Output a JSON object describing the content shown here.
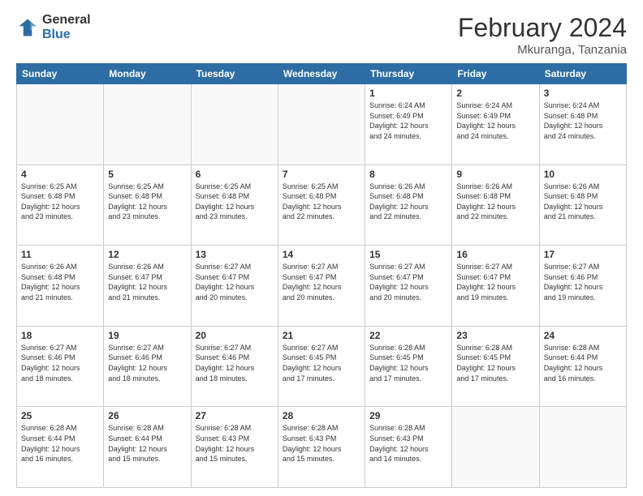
{
  "logo": {
    "general": "General",
    "blue": "Blue"
  },
  "title": "February 2024",
  "subtitle": "Mkuranga, Tanzania",
  "headers": [
    "Sunday",
    "Monday",
    "Tuesday",
    "Wednesday",
    "Thursday",
    "Friday",
    "Saturday"
  ],
  "weeks": [
    [
      {
        "day": "",
        "info": ""
      },
      {
        "day": "",
        "info": ""
      },
      {
        "day": "",
        "info": ""
      },
      {
        "day": "",
        "info": ""
      },
      {
        "day": "1",
        "info": "Sunrise: 6:24 AM\nSunset: 6:49 PM\nDaylight: 12 hours\nand 24 minutes."
      },
      {
        "day": "2",
        "info": "Sunrise: 6:24 AM\nSunset: 6:49 PM\nDaylight: 12 hours\nand 24 minutes."
      },
      {
        "day": "3",
        "info": "Sunrise: 6:24 AM\nSunset: 6:48 PM\nDaylight: 12 hours\nand 24 minutes."
      }
    ],
    [
      {
        "day": "4",
        "info": "Sunrise: 6:25 AM\nSunset: 6:48 PM\nDaylight: 12 hours\nand 23 minutes."
      },
      {
        "day": "5",
        "info": "Sunrise: 6:25 AM\nSunset: 6:48 PM\nDaylight: 12 hours\nand 23 minutes."
      },
      {
        "day": "6",
        "info": "Sunrise: 6:25 AM\nSunset: 6:48 PM\nDaylight: 12 hours\nand 23 minutes."
      },
      {
        "day": "7",
        "info": "Sunrise: 6:25 AM\nSunset: 6:48 PM\nDaylight: 12 hours\nand 22 minutes."
      },
      {
        "day": "8",
        "info": "Sunrise: 6:26 AM\nSunset: 6:48 PM\nDaylight: 12 hours\nand 22 minutes."
      },
      {
        "day": "9",
        "info": "Sunrise: 6:26 AM\nSunset: 6:48 PM\nDaylight: 12 hours\nand 22 minutes."
      },
      {
        "day": "10",
        "info": "Sunrise: 6:26 AM\nSunset: 6:48 PM\nDaylight: 12 hours\nand 21 minutes."
      }
    ],
    [
      {
        "day": "11",
        "info": "Sunrise: 6:26 AM\nSunset: 6:48 PM\nDaylight: 12 hours\nand 21 minutes."
      },
      {
        "day": "12",
        "info": "Sunrise: 6:26 AM\nSunset: 6:47 PM\nDaylight: 12 hours\nand 21 minutes."
      },
      {
        "day": "13",
        "info": "Sunrise: 6:27 AM\nSunset: 6:47 PM\nDaylight: 12 hours\nand 20 minutes."
      },
      {
        "day": "14",
        "info": "Sunrise: 6:27 AM\nSunset: 6:47 PM\nDaylight: 12 hours\nand 20 minutes."
      },
      {
        "day": "15",
        "info": "Sunrise: 6:27 AM\nSunset: 6:47 PM\nDaylight: 12 hours\nand 20 minutes."
      },
      {
        "day": "16",
        "info": "Sunrise: 6:27 AM\nSunset: 6:47 PM\nDaylight: 12 hours\nand 19 minutes."
      },
      {
        "day": "17",
        "info": "Sunrise: 6:27 AM\nSunset: 6:46 PM\nDaylight: 12 hours\nand 19 minutes."
      }
    ],
    [
      {
        "day": "18",
        "info": "Sunrise: 6:27 AM\nSunset: 6:46 PM\nDaylight: 12 hours\nand 18 minutes."
      },
      {
        "day": "19",
        "info": "Sunrise: 6:27 AM\nSunset: 6:46 PM\nDaylight: 12 hours\nand 18 minutes."
      },
      {
        "day": "20",
        "info": "Sunrise: 6:27 AM\nSunset: 6:46 PM\nDaylight: 12 hours\nand 18 minutes."
      },
      {
        "day": "21",
        "info": "Sunrise: 6:27 AM\nSunset: 6:45 PM\nDaylight: 12 hours\nand 17 minutes."
      },
      {
        "day": "22",
        "info": "Sunrise: 6:28 AM\nSunset: 6:45 PM\nDaylight: 12 hours\nand 17 minutes."
      },
      {
        "day": "23",
        "info": "Sunrise: 6:28 AM\nSunset: 6:45 PM\nDaylight: 12 hours\nand 17 minutes."
      },
      {
        "day": "24",
        "info": "Sunrise: 6:28 AM\nSunset: 6:44 PM\nDaylight: 12 hours\nand 16 minutes."
      }
    ],
    [
      {
        "day": "25",
        "info": "Sunrise: 6:28 AM\nSunset: 6:44 PM\nDaylight: 12 hours\nand 16 minutes."
      },
      {
        "day": "26",
        "info": "Sunrise: 6:28 AM\nSunset: 6:44 PM\nDaylight: 12 hours\nand 15 minutes."
      },
      {
        "day": "27",
        "info": "Sunrise: 6:28 AM\nSunset: 6:43 PM\nDaylight: 12 hours\nand 15 minutes."
      },
      {
        "day": "28",
        "info": "Sunrise: 6:28 AM\nSunset: 6:43 PM\nDaylight: 12 hours\nand 15 minutes."
      },
      {
        "day": "29",
        "info": "Sunrise: 6:28 AM\nSunset: 6:43 PM\nDaylight: 12 hours\nand 14 minutes."
      },
      {
        "day": "",
        "info": ""
      },
      {
        "day": "",
        "info": ""
      }
    ]
  ]
}
